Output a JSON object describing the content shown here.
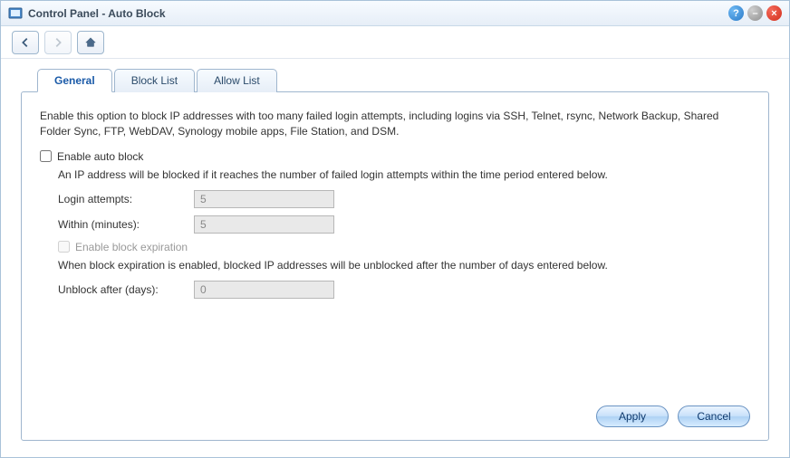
{
  "window": {
    "title": "Control Panel - Auto Block"
  },
  "tabs": [
    {
      "label": "General",
      "active": true
    },
    {
      "label": "Block List",
      "active": false
    },
    {
      "label": "Allow List",
      "active": false
    }
  ],
  "general": {
    "description": "Enable this option to block IP addresses with too many failed login attempts, including logins via SSH, Telnet, rsync, Network Backup, Shared Folder Sync, FTP, WebDAV, Synology mobile apps, File Station, and DSM.",
    "enable_label": "Enable auto block",
    "enable_checked": false,
    "block_condition_text": "An IP address will be blocked if it reaches the number of failed login attempts within the time period entered below.",
    "login_attempts_label": "Login attempts:",
    "login_attempts_value": "5",
    "within_minutes_label": "Within (minutes):",
    "within_minutes_value": "5",
    "expiration_label": "Enable block expiration",
    "expiration_checked": false,
    "expiration_desc": "When block expiration is enabled, blocked IP addresses will be unblocked after the number of days entered below.",
    "unblock_after_label": "Unblock after (days):",
    "unblock_after_value": "0"
  },
  "buttons": {
    "apply": "Apply",
    "cancel": "Cancel"
  }
}
